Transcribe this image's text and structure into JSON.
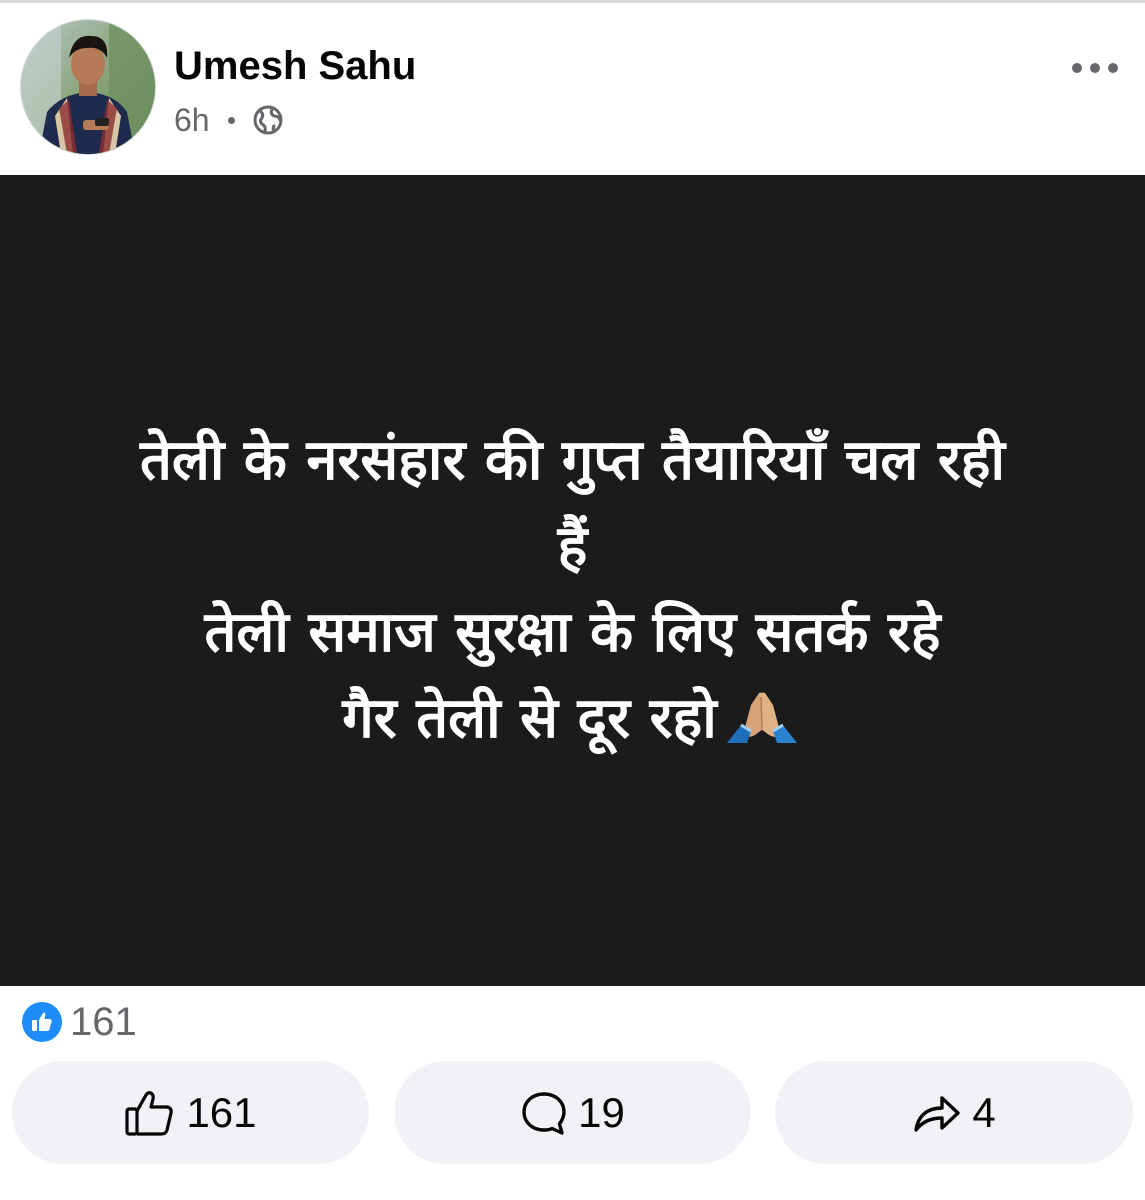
{
  "post": {
    "author": "Umesh Sahu",
    "timestamp": "6h",
    "audience_icon": "globe-icon",
    "menu_icon": "more-options-icon",
    "background_color": "#1b1b1b",
    "text_color": "#ffffff",
    "text_lines": [
      "तेली के नरसंहार की गुप्त तैयारियाँ चल रही",
      "हैं",
      "तेली समाज सुरक्षा के लिए सतर्क रहे",
      "गैर तेली से दूर रहो"
    ],
    "text_emoji": "folded-hands-icon"
  },
  "reactions": {
    "icon": "like-badge-icon",
    "count": "161"
  },
  "actions": {
    "like_count": "161",
    "comment_count": "19",
    "share_count": "4"
  },
  "colors": {
    "like_blue": "#1d8cf8",
    "secondary_text": "#65676b",
    "button_bg": "#f0f2f5"
  }
}
